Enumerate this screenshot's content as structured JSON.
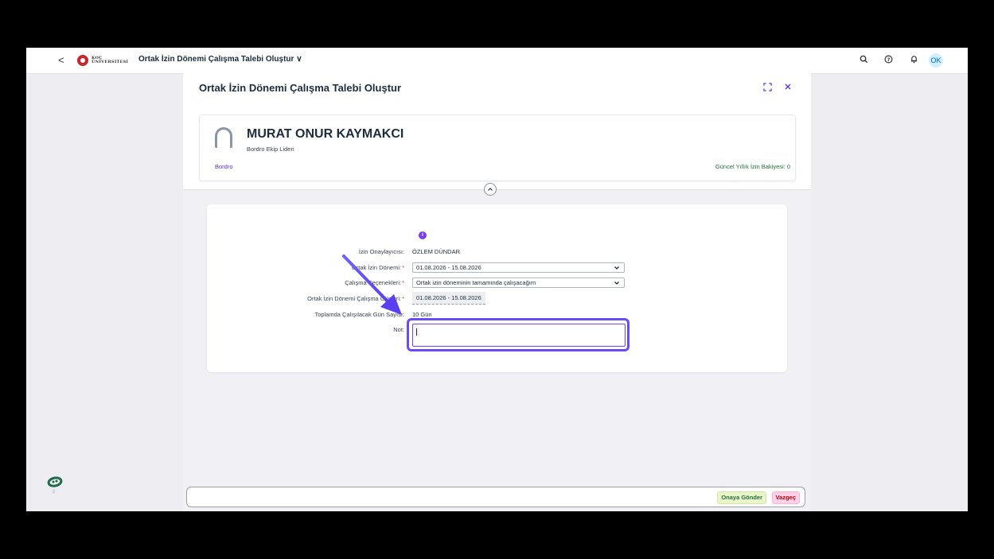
{
  "shellbar": {
    "back_glyph": "<",
    "logo_line1": "KOÇ",
    "logo_line2": "ÜNİVERSİTESİ",
    "app_title": "Ortak İzin Dönemi Çalışma Talebi Oluştur ∨",
    "user_initials": "OK"
  },
  "page": {
    "title": "Ortak İzin Dönemi Çalışma Talebi Oluştur"
  },
  "profile": {
    "name": "MURAT ONUR KAYMAKCI",
    "role": "Bordro Ekip Lideri",
    "department_link": "Bordro",
    "balance": "Güncel Yıllık İzin Bakiyesi: 0"
  },
  "form": {
    "approver_label": "İzin Onaylayıcısı:",
    "approver_value": "ÖZLEM DÜNDAR",
    "period_label": "Ortak İzin Dönemi:",
    "period_value": "01.08.2026 - 15.08.2026",
    "options_label": "Çalışma Seçenekleri:",
    "options_value": "Ortak izin döneminin tamamında çalışacağım",
    "dates_label": "Ortak İzin Dönemi Çalışma Günleri:",
    "dates_value": "01.08.2026 - 15.08.2026",
    "total_label": "Toplamda Çalışılacak Gün Sayısı:",
    "total_value": "10 Gün",
    "note_label": "Not:",
    "required_mark": "*"
  },
  "footer": {
    "submit_label": "Onaya Gönder",
    "cancel_label": "Vazgeç"
  },
  "colors": {
    "accent": "#5a2fd6",
    "highlight": "#6a4cf5",
    "positive": "#256f3a",
    "negative": "#aa0808"
  },
  "icons": [
    "back-icon",
    "search-icon",
    "help-icon",
    "bell-icon",
    "fullscreen-icon",
    "close-icon",
    "person-icon",
    "info-icon",
    "chevron-down-icon",
    "collapse-icon",
    "joule-icon",
    "annotation-arrow"
  ]
}
